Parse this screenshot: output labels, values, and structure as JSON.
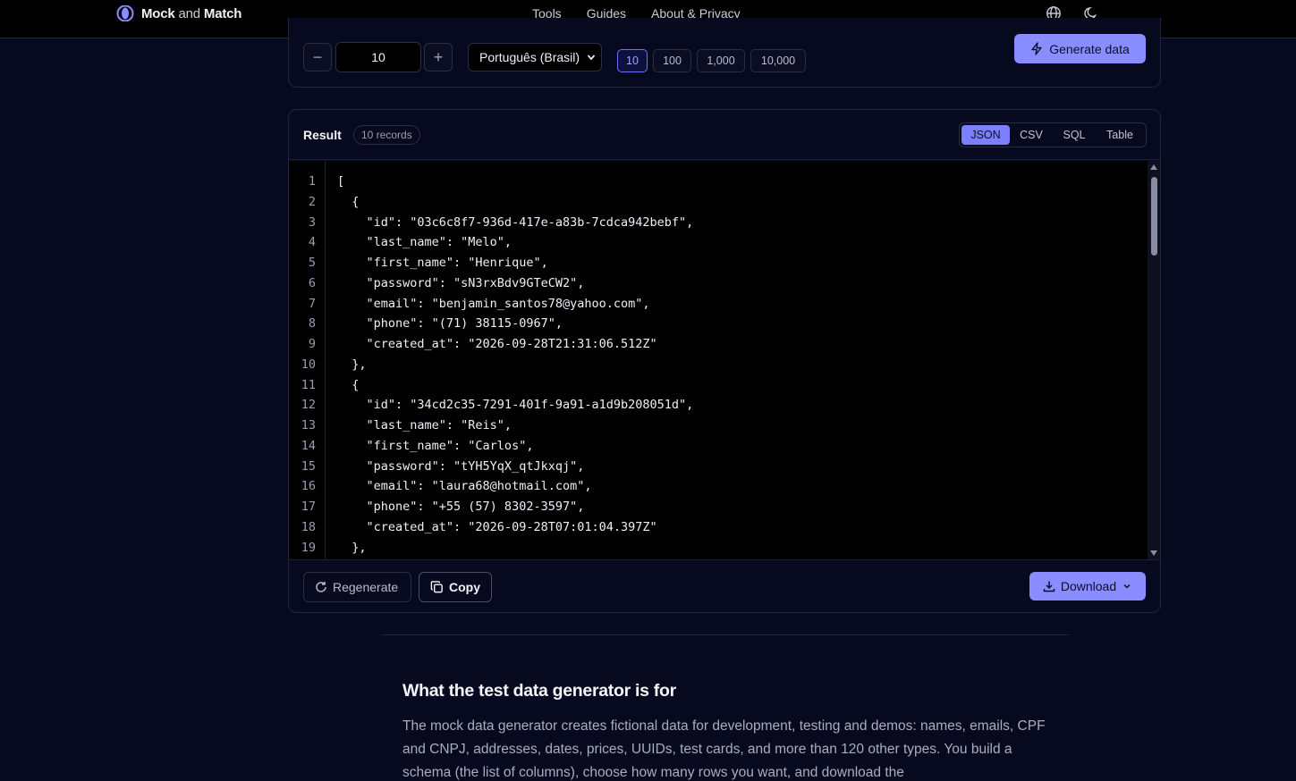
{
  "header": {
    "brand_strong": "Mock",
    "brand_and": "and",
    "brand_match": "Match",
    "nav": [
      "Tools",
      "Guides",
      "About & Privacy"
    ],
    "icons": [
      "globe-icon",
      "moon-icon"
    ]
  },
  "controls": {
    "decrement": "−",
    "increment": "+",
    "quantity": "10",
    "locale": "Português (Brasil)",
    "presets": [
      "10",
      "100",
      "1,000",
      "10,000"
    ],
    "active_preset": "10",
    "generate_label": "Generate data"
  },
  "result": {
    "title": "Result",
    "records_badge": "10 records",
    "tabs": [
      "JSON",
      "CSV",
      "SQL",
      "Table"
    ],
    "active_tab": "JSON",
    "line_numbers": [
      "1",
      "2",
      "3",
      "4",
      "5",
      "6",
      "7",
      "8",
      "9",
      "10",
      "11",
      "12",
      "13",
      "14",
      "15",
      "16",
      "17",
      "18",
      "19"
    ],
    "code_lines": [
      "[",
      "  {",
      "    \"id\": \"03c6c8f7-936d-417e-a83b-7cdca942bebf\",",
      "    \"last_name\": \"Melo\",",
      "    \"first_name\": \"Henrique\",",
      "    \"password\": \"sN3rxBdv9GTeCW2\",",
      "    \"email\": \"benjamin_santos78@yahoo.com\",",
      "    \"phone\": \"(71) 38115-0967\",",
      "    \"created_at\": \"2026-09-28T21:31:06.512Z\"",
      "  },",
      "  {",
      "    \"id\": \"34cd2c35-7291-401f-9a91-a1d9b208051d\",",
      "    \"last_name\": \"Reis\",",
      "    \"first_name\": \"Carlos\",",
      "    \"password\": \"tYH5YqX_qtJkxqj\",",
      "    \"email\": \"laura68@hotmail.com\",",
      "    \"phone\": \"+55 (57) 8302-3597\",",
      "    \"created_at\": \"2026-09-28T07:01:04.397Z\"",
      "  },"
    ],
    "regenerate_label": "Regenerate",
    "copy_label": "Copy",
    "download_label": "Download"
  },
  "info": {
    "title": "What the test data generator is for",
    "body": "The mock data generator creates fictional data for development, testing and demos: names, emails, CPF and CNPJ, addresses, dates, prices, UUIDs, test cards, and more than 120 other types. You build a schema (the list of columns), choose how many rows you want, and download the"
  },
  "colors": {
    "accent": "#8a8dff",
    "background": "#070a1f",
    "code_background": "#000000"
  }
}
